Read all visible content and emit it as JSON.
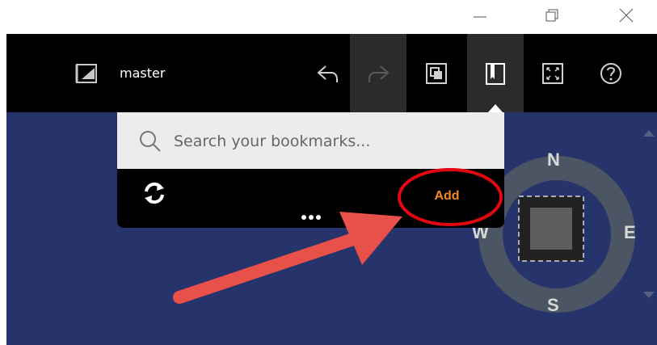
{
  "window": {
    "controls": [
      "minimize-icon",
      "restore-icon",
      "close-icon"
    ]
  },
  "toolbar": {
    "scene_label": "master",
    "icons": [
      "scene-icon",
      "undo-icon",
      "redo-icon",
      "layers-icon",
      "bookmark-icon",
      "fullscreen-icon",
      "help-icon"
    ]
  },
  "bookmarks_popup": {
    "search_placeholder": "Search your bookmarks...",
    "add_label": "Add",
    "more_label": "•••"
  },
  "compass": {
    "north": "N",
    "east": "E",
    "south": "S",
    "west": "W"
  },
  "colors": {
    "accent": "#f08a24",
    "map_bg": "#26346b",
    "annotation": "#e8504a"
  }
}
